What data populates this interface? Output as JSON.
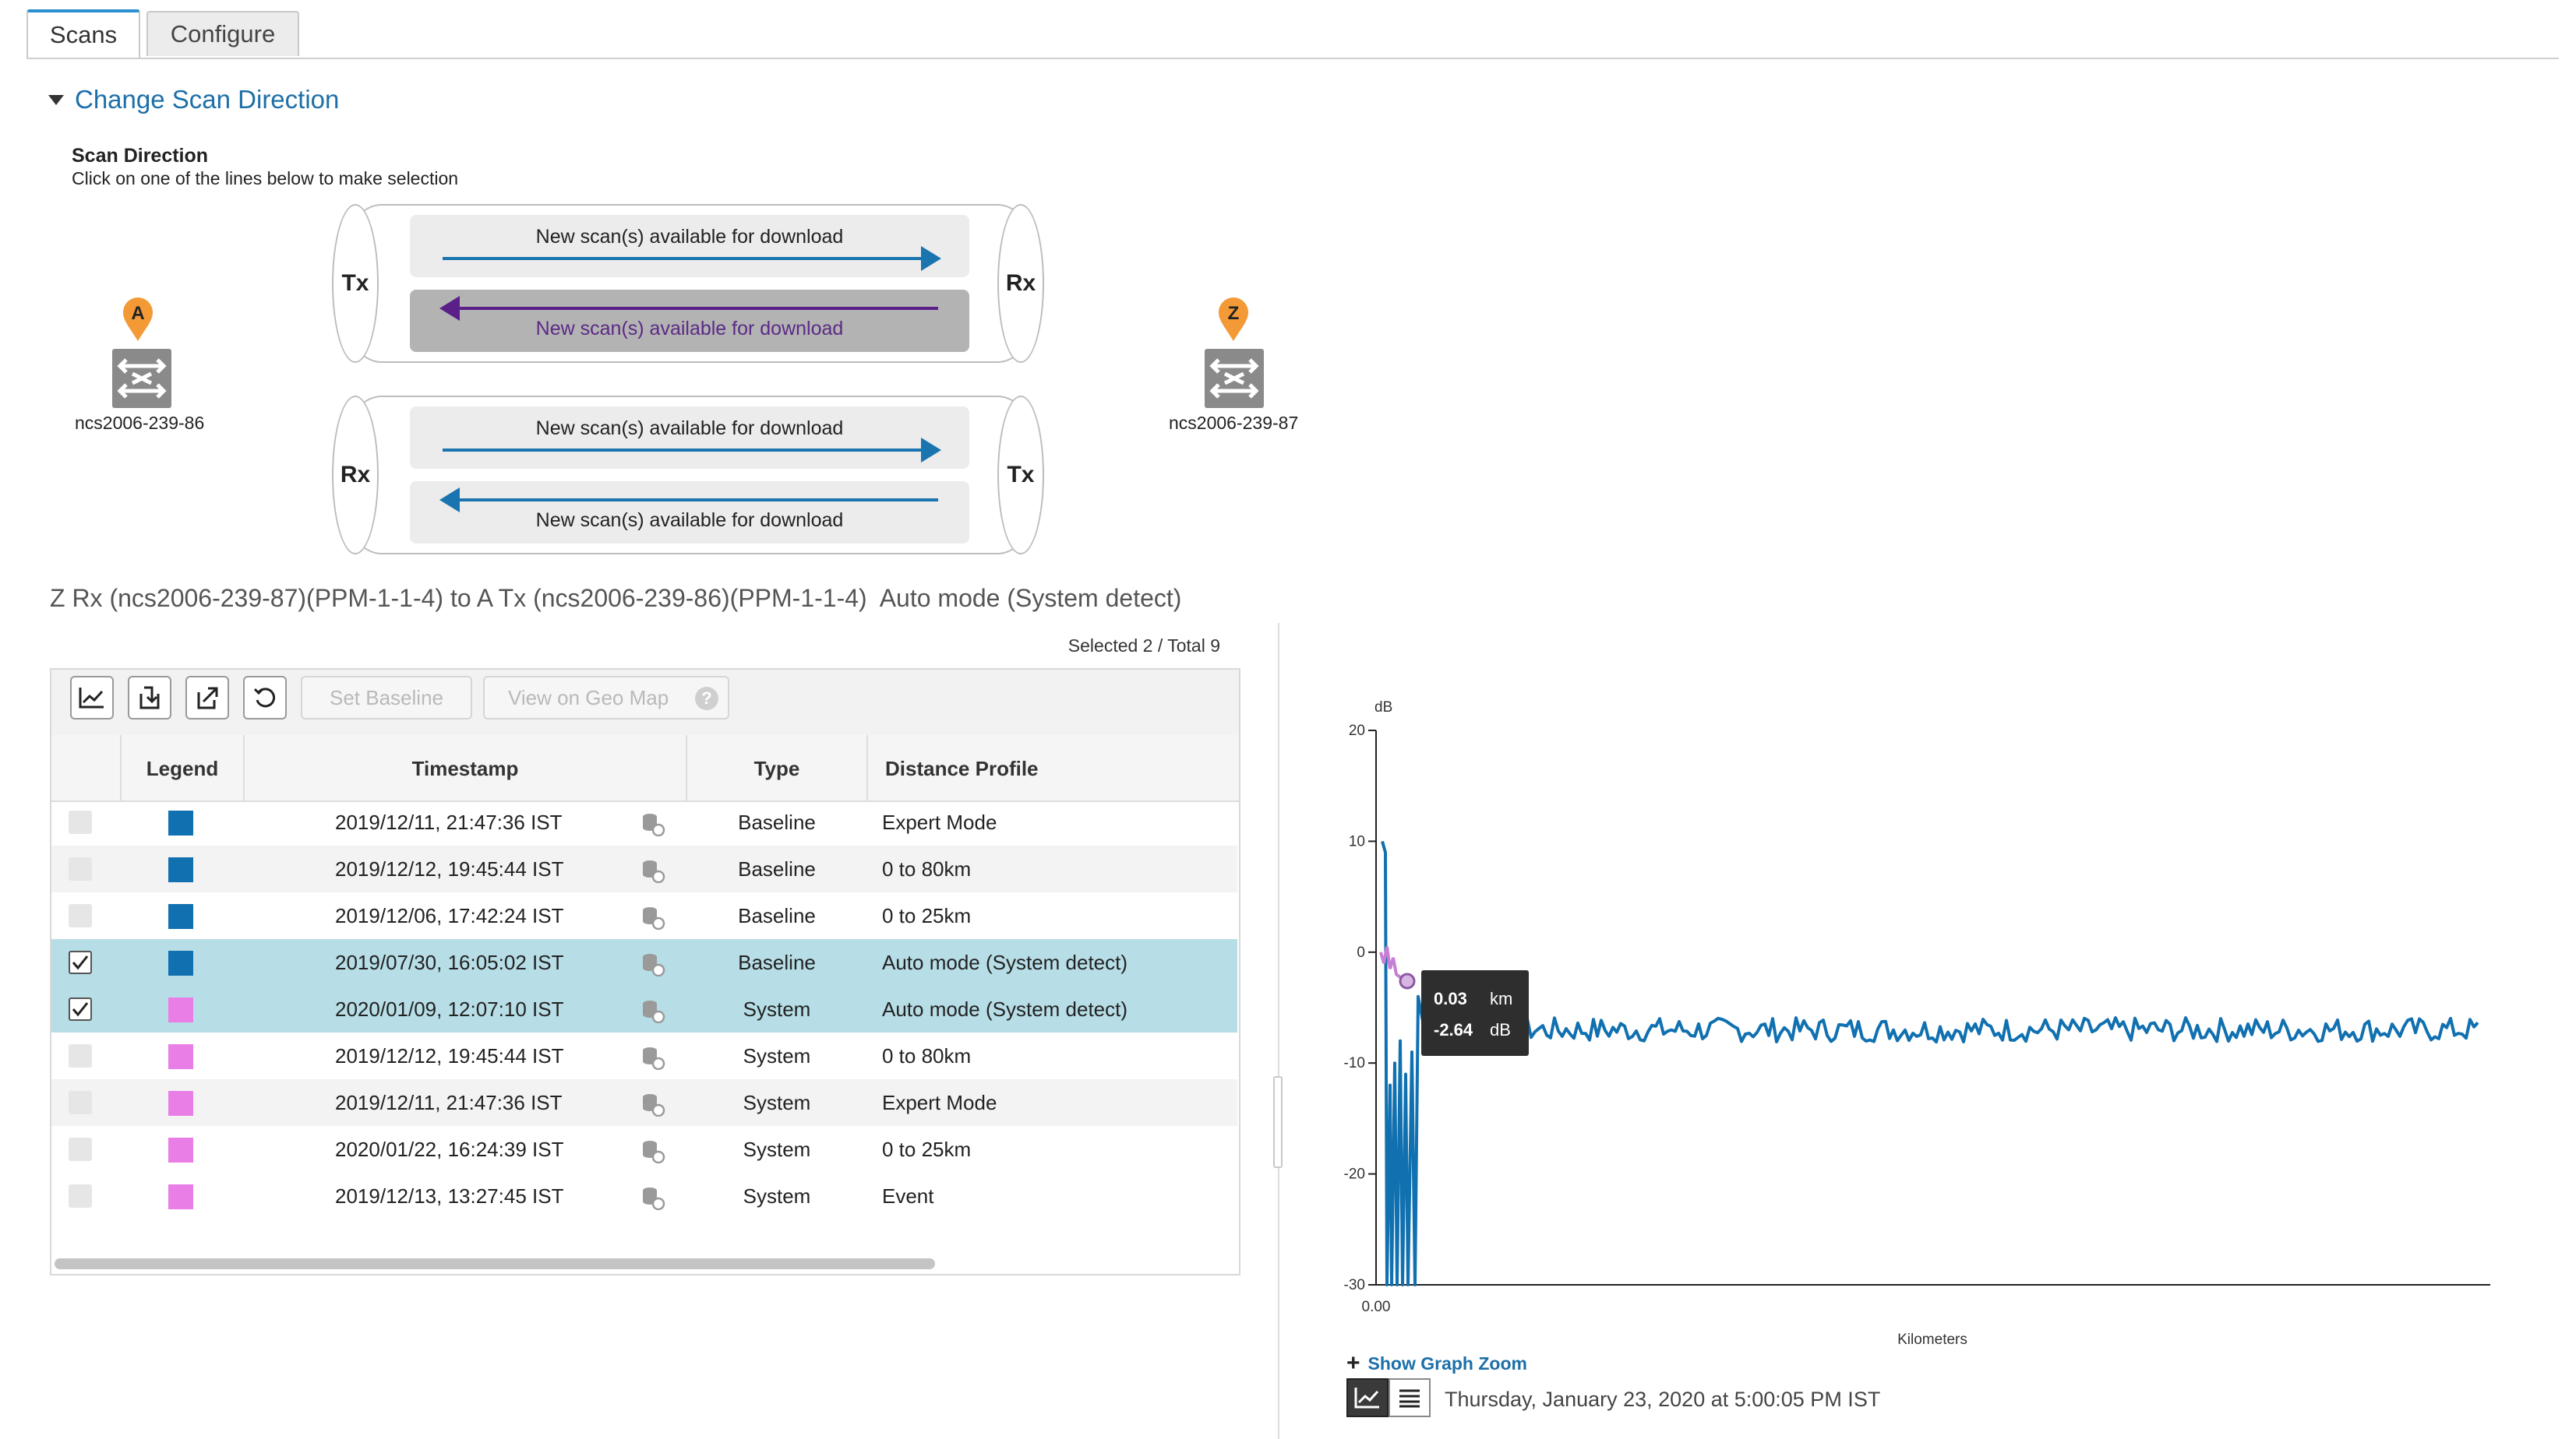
{
  "tabs": [
    {
      "label": "Scans"
    },
    {
      "label": "Configure"
    }
  ],
  "section": {
    "title": "Change Scan Direction"
  },
  "scan_direction": {
    "heading": "Scan Direction",
    "instruction": "Click on one of the lines below to make selection",
    "node_a": {
      "marker": "A",
      "name": "ncs2006-239-86"
    },
    "node_z": {
      "marker": "Z",
      "name": "ncs2006-239-87"
    },
    "fibers": [
      {
        "left": "Tx",
        "right": "Rx",
        "lanes": [
          {
            "label": "New scan(s) available for download",
            "direction": "right",
            "selected": false,
            "color": "#1a74b0"
          },
          {
            "label": "New scan(s) available for download",
            "direction": "left",
            "selected": true,
            "color": "#5b1f8a"
          }
        ]
      },
      {
        "left": "Rx",
        "right": "Tx",
        "lanes": [
          {
            "label": "New scan(s) available for download",
            "direction": "right",
            "selected": false,
            "color": "#1a74b0"
          },
          {
            "label": "New scan(s) available for download",
            "direction": "left",
            "selected": false,
            "color": "#1a74b0"
          }
        ]
      }
    ]
  },
  "route_title": "Z Rx (ncs2006-239-87)(PPM-1-1-4) to A Tx (ncs2006-239-86)(PPM-1-1-4)  Auto mode (System detect)",
  "selection_count": "Selected 2 / Total 9",
  "toolbar": {
    "set_baseline": "Set Baseline",
    "view_geo_map": "View on Geo Map",
    "help_glyph": "?"
  },
  "table": {
    "columns": [
      "Legend",
      "Timestamp",
      "Type",
      "Distance Profile"
    ],
    "rows": [
      {
        "checked": false,
        "color": "#1070b0",
        "timestamp": "2019/12/11, 21:47:36 IST",
        "type": "Baseline",
        "profile": "Expert Mode"
      },
      {
        "checked": false,
        "color": "#1070b0",
        "timestamp": "2019/12/12, 19:45:44 IST",
        "type": "Baseline",
        "profile": "0 to 80km"
      },
      {
        "checked": false,
        "color": "#1070b0",
        "timestamp": "2019/12/06, 17:42:24 IST",
        "type": "Baseline",
        "profile": "0 to 25km"
      },
      {
        "checked": true,
        "color": "#1070b0",
        "timestamp": "2019/07/30, 16:05:02 IST",
        "type": "Baseline",
        "profile": "Auto mode (System detect)"
      },
      {
        "checked": true,
        "color": "#e97ee6",
        "timestamp": "2020/01/09, 12:07:10 IST",
        "type": "System",
        "profile": "Auto mode (System detect)"
      },
      {
        "checked": false,
        "color": "#e97ee6",
        "timestamp": "2019/12/12, 19:45:44 IST",
        "type": "System",
        "profile": "0 to 80km"
      },
      {
        "checked": false,
        "color": "#e97ee6",
        "timestamp": "2019/12/11, 21:47:36 IST",
        "type": "System",
        "profile": "Expert Mode"
      },
      {
        "checked": false,
        "color": "#e97ee6",
        "timestamp": "2020/01/22, 16:24:39 IST",
        "type": "System",
        "profile": "0 to 25km"
      },
      {
        "checked": false,
        "color": "#e97ee6",
        "timestamp": "2019/12/13, 13:27:45 IST",
        "type": "System",
        "profile": "Event"
      }
    ]
  },
  "chart_data": {
    "type": "line",
    "ylabel": "dB",
    "xlabel": "Kilometers",
    "ylim": [
      -30,
      20
    ],
    "yticks": [
      "20",
      "10",
      "0",
      "-10",
      "-20",
      "-30"
    ],
    "xticks": [
      "0.00"
    ],
    "grid": false,
    "series": [
      {
        "color": "#1070b0",
        "note": "trace drops from ~10 dB at origin, deep dips near start, then noisy around -7 dB"
      },
      {
        "color": "#c77fd6",
        "note": "short trace near origin, ~0 to -2.6 dB"
      }
    ],
    "tooltip": {
      "x": "0.03",
      "x_unit": "km",
      "y": "-2.64",
      "y_unit": "dB"
    }
  },
  "chart_footer": {
    "zoom_link": "Show Graph Zoom",
    "zoom_plus": "+",
    "timestamp": "Thursday, January 23, 2020 at 5:00:05 PM IST"
  }
}
